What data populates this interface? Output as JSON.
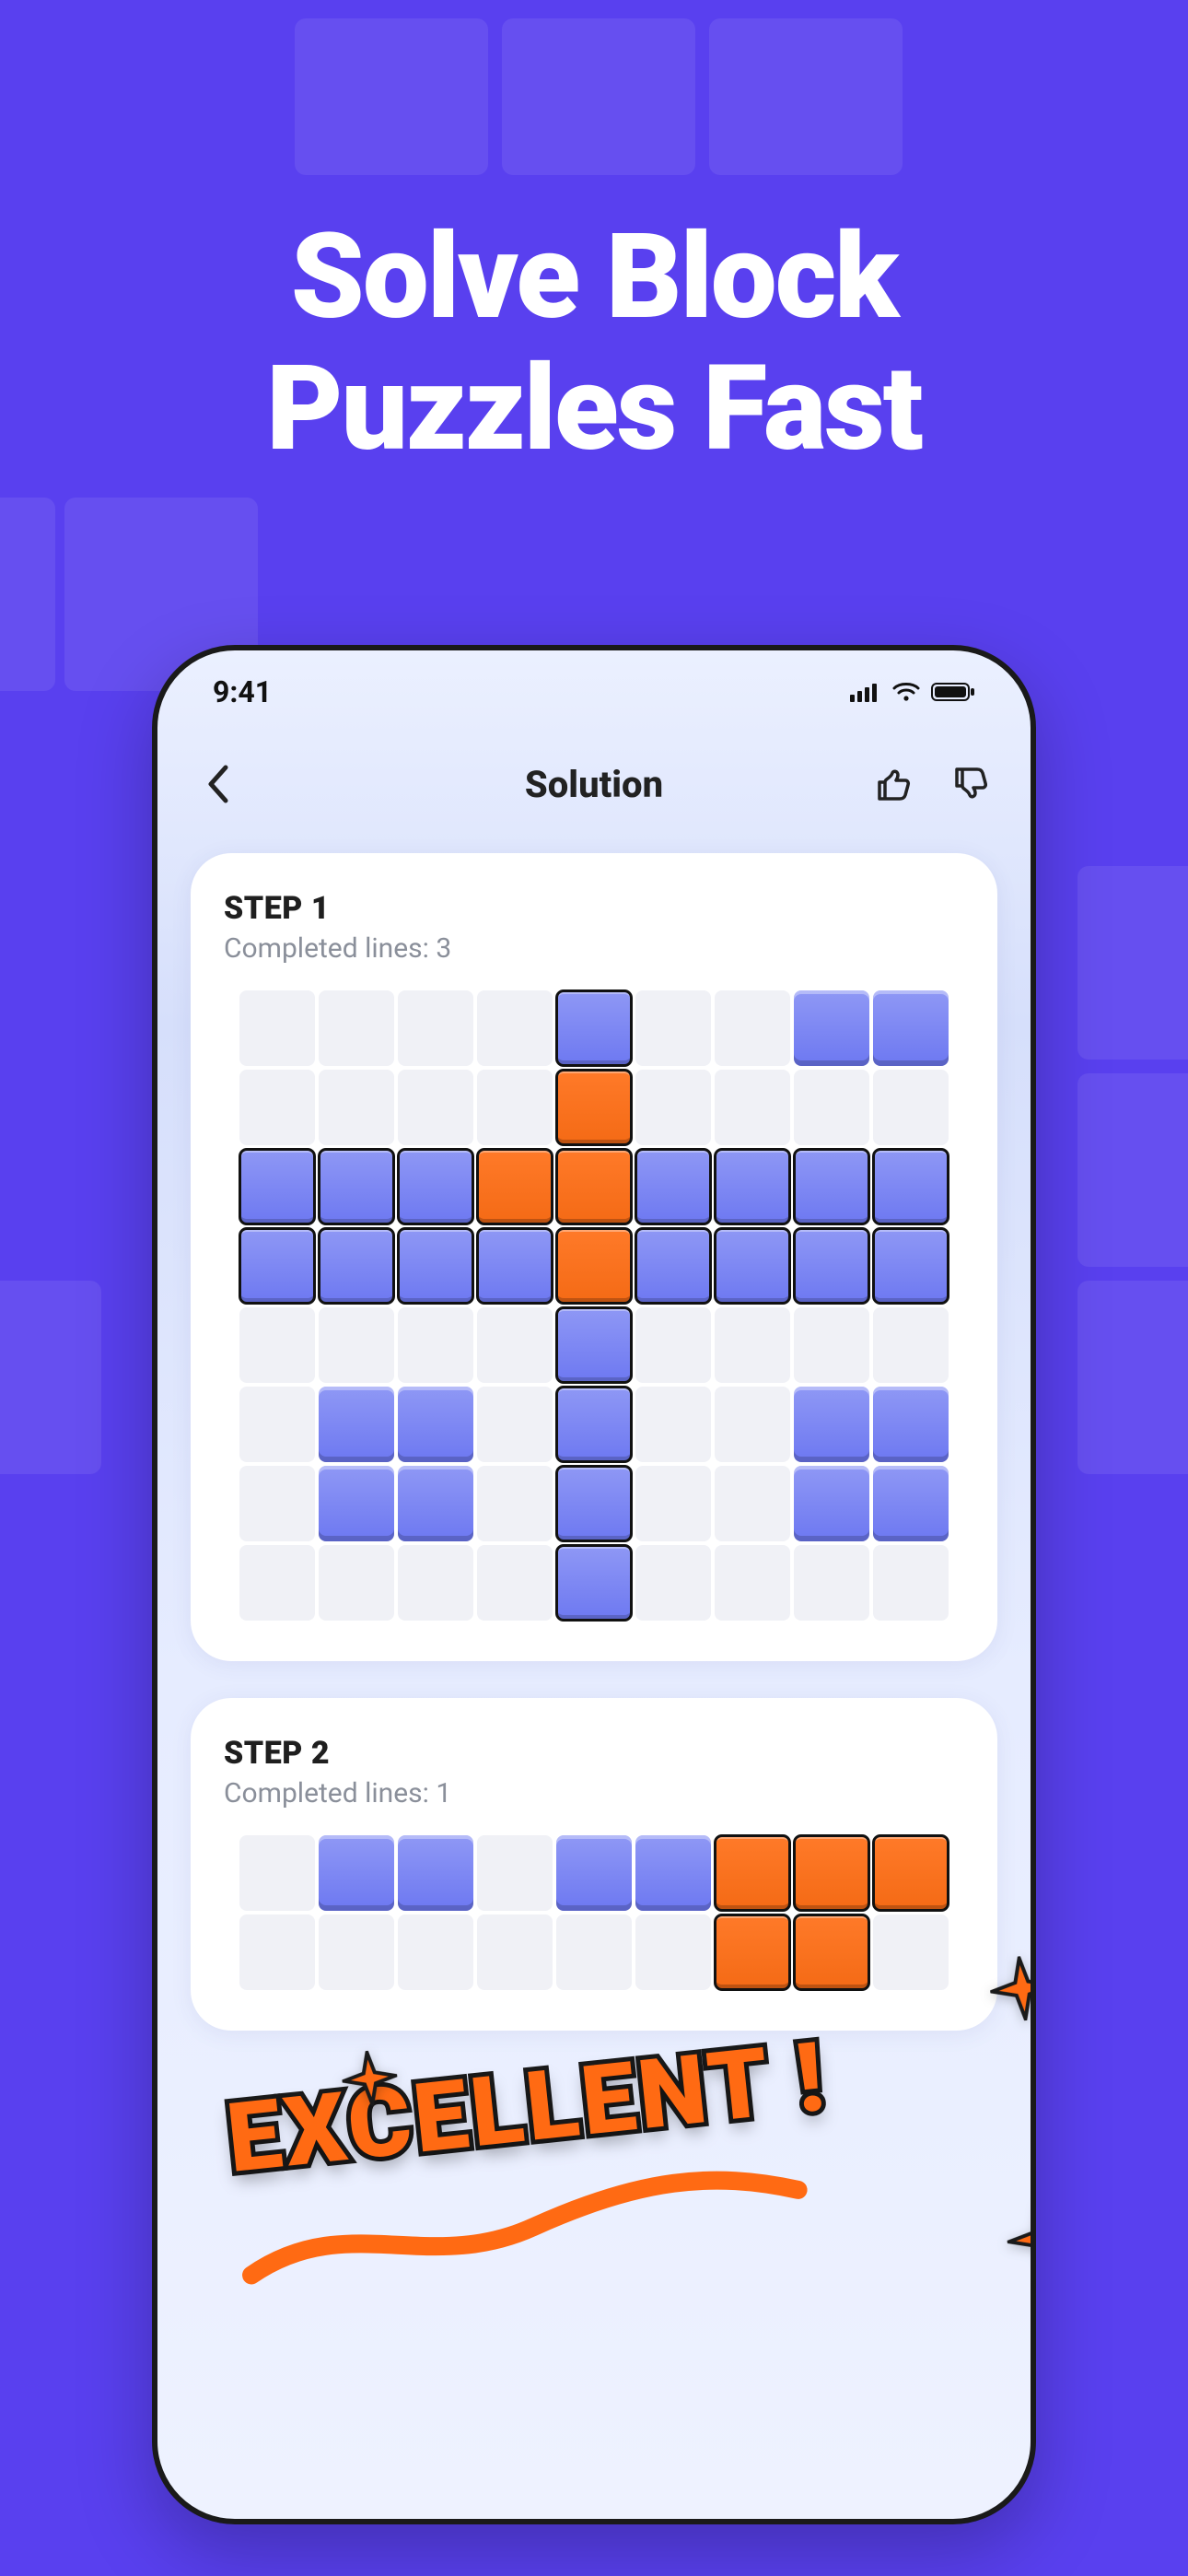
{
  "headline_line1": "Solve Block",
  "headline_line2": "Puzzles Fast",
  "status": {
    "time": "9:41"
  },
  "nav": {
    "title": "Solution"
  },
  "steps": [
    {
      "label": "STEP 1",
      "completed_text": "Completed lines: 3",
      "cols": 9,
      "cell_size": 82,
      "grid": [
        [
          0,
          0,
          0,
          0,
          2,
          0,
          0,
          1,
          1
        ],
        [
          0,
          0,
          0,
          0,
          3,
          0,
          0,
          0,
          0
        ],
        [
          2,
          2,
          2,
          3,
          3,
          2,
          2,
          2,
          2
        ],
        [
          2,
          2,
          2,
          2,
          3,
          2,
          2,
          2,
          2
        ],
        [
          0,
          0,
          0,
          0,
          2,
          0,
          0,
          0,
          0
        ],
        [
          0,
          1,
          1,
          0,
          2,
          0,
          0,
          1,
          1
        ],
        [
          0,
          1,
          1,
          0,
          2,
          0,
          0,
          1,
          1
        ],
        [
          0,
          0,
          0,
          0,
          2,
          0,
          0,
          0,
          0
        ]
      ]
    },
    {
      "label": "STEP 2",
      "completed_text": "Completed lines: 1",
      "cols": 9,
      "cell_size": 82,
      "grid": [
        [
          0,
          1,
          1,
          0,
          1,
          1,
          3,
          3,
          3
        ],
        [
          0,
          0,
          0,
          0,
          0,
          0,
          3,
          3,
          0
        ]
      ]
    }
  ],
  "overlay": {
    "excellent": "EXCELLENT !"
  }
}
